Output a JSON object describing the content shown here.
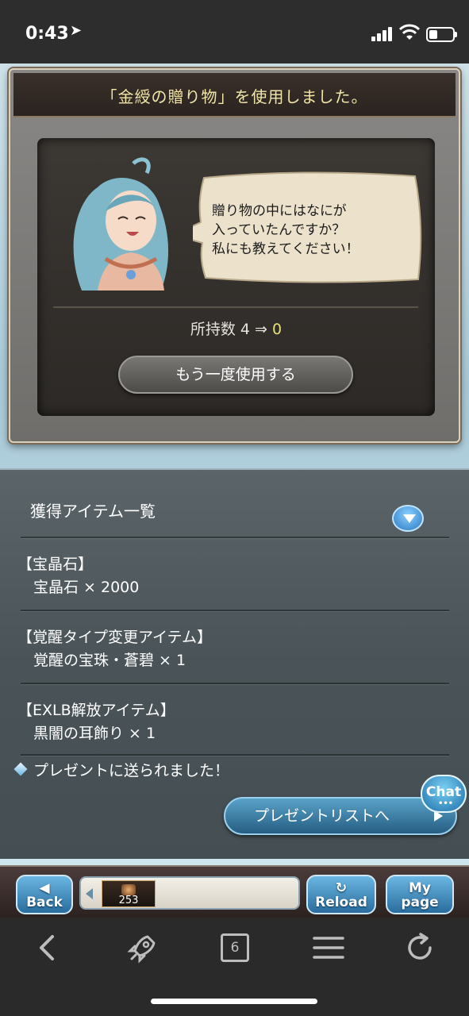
{
  "status_bar": {
    "time": "0:43",
    "battery_fraction": 0.35
  },
  "dialog": {
    "title": "「金綬の贈り物」を使用しました。",
    "speech": "贈り物の中にはなにが\n入っていたんですか？\n私にも教えてください！",
    "owned_label": "所持数 4 ⇒ ",
    "owned_after": "0",
    "use_again_label": "もう一度使用する"
  },
  "items_panel": {
    "header": "獲得アイテム一覧",
    "groups": [
      {
        "title": "【宝晶石】",
        "item": "宝晶石 × 2000"
      },
      {
        "title": "【覚醒タイプ変更アイテム】",
        "item": "覚醒の宝珠・蒼碧 × 1"
      },
      {
        "title": "【EXLB解放アイテム】",
        "item": "黒闇の耳飾り × 1"
      }
    ],
    "sent_message": "プレゼントに送られました！",
    "present_list_label": "プレゼントリストへ",
    "chat_label": "Chat"
  },
  "game_nav": {
    "back_label": "Back",
    "reload_label": "Reload",
    "mypage_line1": "My",
    "mypage_line2": "page",
    "tray_count": "253"
  },
  "browser_toolbar": {
    "tab_count": "6"
  },
  "icons": [
    "location-arrow-icon",
    "signal-icon",
    "wifi-icon",
    "battery-icon",
    "chevron-down-icon",
    "diamond-icon",
    "back-arrow-icon",
    "rocket-icon",
    "tabs-icon",
    "menu-icon",
    "reload-icon"
  ],
  "colors": {
    "title_gold": "#f1e6a8",
    "count_yellow": "#e7e07a",
    "button_blue": "#2a6d9e"
  }
}
